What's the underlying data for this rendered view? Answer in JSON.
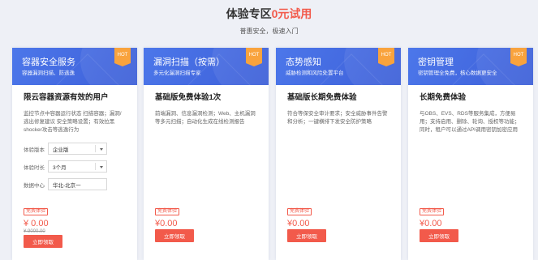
{
  "header": {
    "title_main": "体验专区",
    "title_accent": "0元试用",
    "subtitle": "普惠安全，极速入门"
  },
  "colors": {
    "brand_blue": "#4c77ea",
    "accent_red": "#f25a4b",
    "hot_orange": "#f9a33d"
  },
  "cards": [
    {
      "title": "容器安全服务",
      "desc": "容器漏洞扫描、防逃逸",
      "hot": "HOT",
      "offer_title": "限云容器资源有效的用户",
      "offer_desc": "监控节点中容器运行状态 扫描容器；漏洞/逃出修复建议 安全策略设置；有效拉黑shocker攻击等逃逸行为",
      "form": {
        "version_label": "体验版本",
        "version_value": "企业版",
        "duration_label": "体验时长",
        "duration_value": "3个月",
        "region_label": "数据中心",
        "region_value": "华北-北京一"
      },
      "free_tag": "免费体验",
      "price": "¥ 0.00",
      "orig_price": "¥ 9000.00",
      "button": "立即领取"
    },
    {
      "title": "漏洞扫描（按需）",
      "desc": "多元化漏洞扫描专家",
      "hot": "HOT",
      "offer_title": "基础版免费体验1次",
      "offer_desc": "前端漏洞、信息漏洞检测；Web、主机漏洞等多元扫描；自动化生成在线检测报告",
      "free_tag": "免费体验",
      "price": "¥0.00",
      "button": "立即领取"
    },
    {
      "title": "态势感知",
      "desc": "威胁检测和风险处置平台",
      "hot": "HOT",
      "offer_title": "基础版长期免费体验",
      "offer_desc": "符合等保安全审计要求；安全威胁事件告警和分析；一键横排下发安全防护策略",
      "free_tag": "免费体验",
      "price": "¥0.00",
      "button": "立即领取"
    },
    {
      "title": "密钥管理",
      "desc": "密钥管理全免费，核心数据更安全",
      "hot": "HOT",
      "offer_title": "长期免费体验",
      "offer_desc": "与OBS、EVS、RDS等服务集成，方便易用；支持启用、删除、轮询、授权等功能；同时，租户可以通过API调用密钥加密应用",
      "free_tag": "免费体验",
      "price": "¥0.00",
      "button": "立即领取"
    }
  ]
}
